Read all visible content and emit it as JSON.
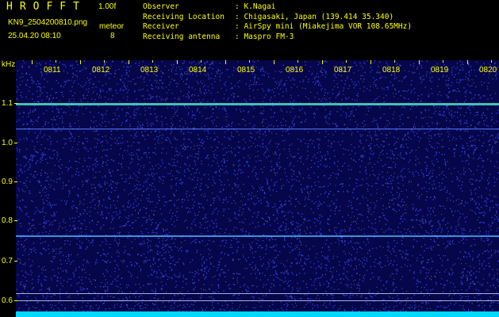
{
  "header": {
    "app_title": "HROFFT",
    "version": "1.00f",
    "file_name": "KN9_2504200810.png",
    "meteor_label": "meteor",
    "datetime": "25.04.20 08:10",
    "meteor_count": "8",
    "info": [
      {
        "key": "Observer",
        "value": ": K.Nagai"
      },
      {
        "key": "Receiving Location",
        "value": ": Chigasaki, Japan (139.414 35.340)"
      },
      {
        "key": "Receiver",
        "value": ": AirSpy mini (Miakejima VOR 108.65MHz)"
      },
      {
        "key": "Receiving antenna",
        "value": ": Maspro FM-3"
      }
    ]
  },
  "spectrogram": {
    "y_unit": "kHz",
    "y_labels": [
      "1.1",
      "1.0",
      "0.9",
      "0.8",
      "0.7",
      "0.6"
    ],
    "x_labels": [
      "0811",
      "0812",
      "0813",
      "0814",
      "0815",
      "0816",
      "0817",
      "0818",
      "0819",
      "0820"
    ],
    "colors": {
      "background": "#06064a",
      "noise": "#3b4fff",
      "trace": "#4fe0c8",
      "floor": "#00d8ff"
    }
  }
}
